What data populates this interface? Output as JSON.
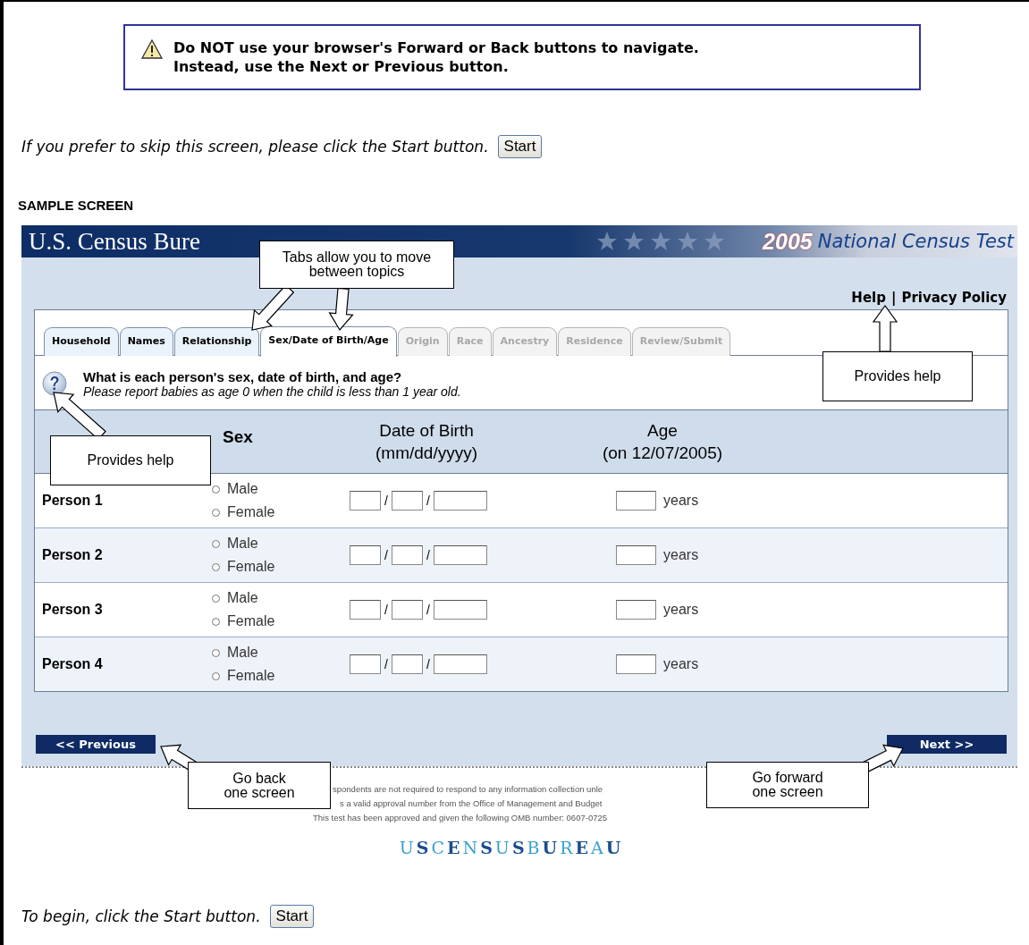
{
  "warning": {
    "lines": [
      "Do NOT use your browser's Forward or Back buttons to navigate.",
      "Instead, use the Next or Previous button."
    ]
  },
  "skip_prompt": {
    "text": "If you prefer to skip this screen, please click the Start button.",
    "button": "Start"
  },
  "sample_heading": "SAMPLE SCREEN",
  "sample": {
    "header": {
      "title": "U.S. Census Bure",
      "year": "2005",
      "subtitle": "National Census Test"
    },
    "links": [
      "Help",
      "Privacy Policy"
    ],
    "link_separator": "|",
    "tabs": [
      {
        "label": "Household",
        "selected": false,
        "disabled": false
      },
      {
        "label": "Names",
        "selected": false,
        "disabled": false
      },
      {
        "label": "Relationship",
        "selected": false,
        "disabled": false
      },
      {
        "label": "Sex/Date of Birth/Age",
        "selected": true,
        "disabled": false
      },
      {
        "label": "Origin",
        "selected": false,
        "disabled": true
      },
      {
        "label": "Race",
        "selected": false,
        "disabled": true
      },
      {
        "label": "Ancestry",
        "selected": false,
        "disabled": true
      },
      {
        "label": "Residence",
        "selected": false,
        "disabled": true
      },
      {
        "label": "Review/Submit",
        "selected": false,
        "disabled": true
      }
    ],
    "question": {
      "title": "What is each person's sex, date of birth, and age?",
      "note": "Please report babies as age 0 when the child is less than 1 year old."
    },
    "columns": [
      {
        "lines": [
          "Sex"
        ]
      },
      {
        "lines": [
          "Date of Birth",
          "(mm/dd/yyyy)"
        ]
      },
      {
        "lines": [
          "Age",
          "(on 12/07/2005)"
        ]
      }
    ],
    "rows": [
      {
        "label": "Person 1",
        "options": [
          {
            "label": "Male",
            "selected": false
          },
          {
            "label": "Female",
            "selected": false
          }
        ],
        "date_separators": [
          "/",
          "/"
        ],
        "age_unit": "years"
      },
      {
        "label": "Person 2",
        "options": [
          {
            "label": "Male",
            "selected": false
          },
          {
            "label": "Female",
            "selected": false
          }
        ],
        "date_separators": [
          "/",
          "/"
        ],
        "age_unit": "years"
      },
      {
        "label": "Person 3",
        "options": [
          {
            "label": "Male",
            "selected": false
          },
          {
            "label": "Female",
            "selected": false
          }
        ],
        "date_separators": [
          "/",
          "/"
        ],
        "age_unit": "years"
      },
      {
        "label": "Person 4",
        "options": [
          {
            "label": "Male",
            "selected": false
          },
          {
            "label": "Female",
            "selected": false
          }
        ],
        "date_separators": [
          "/",
          "/"
        ],
        "age_unit": "years"
      }
    ],
    "previous_button": "<< Previous",
    "next_button": "Next >>",
    "footer_lines": [
      {
        "text": "spondents are not required to respond to any information collection unle"
      },
      {
        "text": "s a valid approval number from the Office of Management and Budget"
      },
      {
        "text": "This test has been approved and given the following OMB number: 0607-0725"
      }
    ],
    "logo": "USCENSUSBUREAU",
    "callouts": [
      {
        "lines": [
          "Tabs allow you to move",
          "between topics"
        ]
      },
      {
        "lines": [
          "Provides help"
        ]
      },
      {
        "lines": [
          "Provides help"
        ]
      },
      {
        "lines": [
          "Go back",
          "one screen"
        ]
      },
      {
        "lines": [
          "Go forward",
          "one screen"
        ]
      }
    ]
  },
  "begin_prompt": {
    "text": "To begin, click the Start button.",
    "button": "Start"
  }
}
